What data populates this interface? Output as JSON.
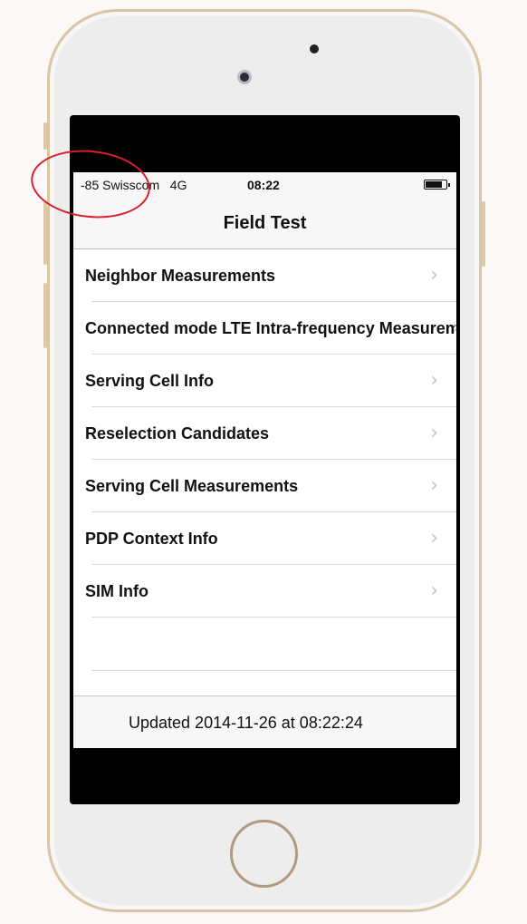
{
  "status_bar": {
    "carrier": "-85 Swisscom   4G",
    "time": "08:22",
    "battery_level": 0.75
  },
  "nav": {
    "title": "Field Test"
  },
  "list": {
    "items": [
      {
        "label": "Neighbor Measurements"
      },
      {
        "label": "Connected mode LTE Intra-frequency Measurements"
      },
      {
        "label": "Serving Cell Info"
      },
      {
        "label": "Reselection Candidates"
      },
      {
        "label": "Serving Cell Measurements"
      },
      {
        "label": "PDP Context Info"
      },
      {
        "label": "SIM Info"
      }
    ],
    "chevron_icon": "chevron-right-icon"
  },
  "toolbar": {
    "updated": "Updated 2014-11-26 at 08:22:24"
  },
  "colors": {
    "annotation": "#d8202a",
    "frame": "#d9c6a4"
  }
}
